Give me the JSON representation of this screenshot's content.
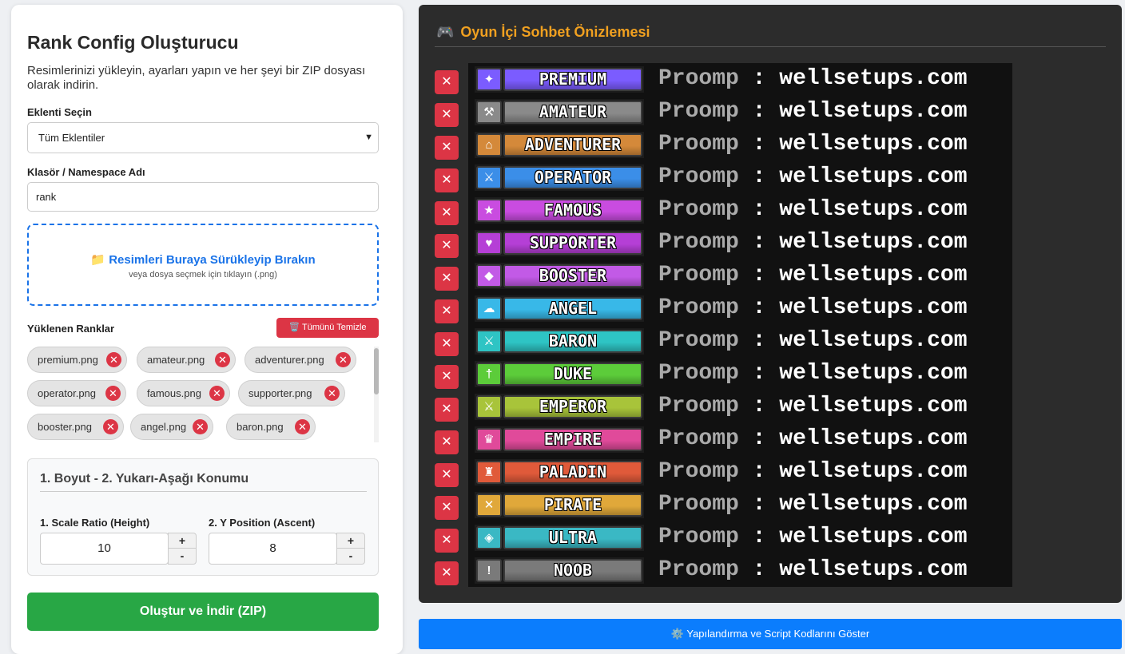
{
  "form": {
    "title": "Rank Config Oluşturucu",
    "description": "Resimlerinizi yükleyin, ayarları yapın ve her şeyi bir ZIP dosyası olarak indirin.",
    "plugin_label": "Eklenti Seçin",
    "plugin_selected": "Tüm Eklentiler",
    "namespace_label": "Klasör / Namespace Adı",
    "namespace_value": "rank",
    "dropzone_title": "📁 Resimleri Buraya Sürükleyip Bırakın",
    "dropzone_sub": "veya dosya seçmek için tıklayın (.png)",
    "uploaded_label": "Yüklenen Ranklar",
    "clear_all": "🗑️ Tümünü Temizle",
    "files": [
      "premium.png",
      "amateur.png",
      "adventurer.png",
      "operator.png",
      "famous.png",
      "supporter.png",
      "booster.png",
      "angel.png",
      "baron.png"
    ],
    "chip_remove": "✕",
    "settings_title": "1. Boyut - 2. Yukarı-Aşağı Konumu",
    "scale_label": "1. Scale Ratio (Height)",
    "scale_value": "10",
    "y_label": "2. Y Position (Ascent)",
    "y_value": "8",
    "plus": "+",
    "minus": "-",
    "generate_button": "Oluştur ve İndir (ZIP)"
  },
  "preview": {
    "title": "Oyun İçi Sohbet Önizlemesi",
    "title_icon": "gamepad-icon",
    "delete_glyph": "✕",
    "player_name": "Proomp",
    "separator": ":",
    "message": "wellsetups.com",
    "ranks": [
      {
        "name": "PREMIUM",
        "color": "#7b5cff",
        "icon": "✦"
      },
      {
        "name": "AMATEUR",
        "color": "#8a8a8a",
        "icon": "⚒"
      },
      {
        "name": "ADVENTURER",
        "color": "#d4893a",
        "icon": "⌂"
      },
      {
        "name": "OPERATOR",
        "color": "#3b8ee8",
        "icon": "⚔"
      },
      {
        "name": "FAMOUS",
        "color": "#c94ce0",
        "icon": "★"
      },
      {
        "name": "SUPPORTER",
        "color": "#b53fd6",
        "icon": "♥"
      },
      {
        "name": "BOOSTER",
        "color": "#c25ae6",
        "icon": "◆"
      },
      {
        "name": "ANGEL",
        "color": "#38b8e8",
        "icon": "☁"
      },
      {
        "name": "BARON",
        "color": "#2ec4c4",
        "icon": "⚔"
      },
      {
        "name": "DUKE",
        "color": "#5ccc3a",
        "icon": "†"
      },
      {
        "name": "EMPEROR",
        "color": "#a8c43a",
        "icon": "⚔"
      },
      {
        "name": "EMPIRE",
        "color": "#e04a9a",
        "icon": "♛"
      },
      {
        "name": "PALADIN",
        "color": "#e05a3a",
        "icon": "♜"
      },
      {
        "name": "PIRATE",
        "color": "#e0a83a",
        "icon": "✕"
      },
      {
        "name": "ULTRA",
        "color": "#3ab8c4",
        "icon": "◈"
      },
      {
        "name": "NOOB",
        "color": "#7a7a7a",
        "icon": "!"
      }
    ]
  },
  "toggle_button": "⚙️ Yapılandırma ve Script Kodlarını Göster"
}
